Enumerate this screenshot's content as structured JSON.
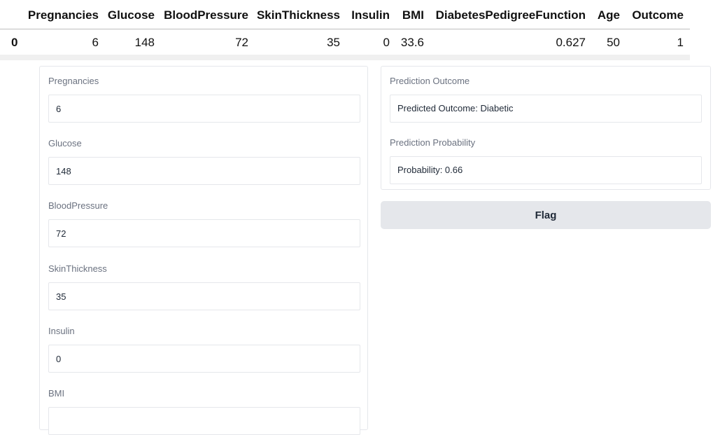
{
  "form": {
    "fields": [
      {
        "label": "Pregnancies",
        "value": "6"
      },
      {
        "label": "Glucose",
        "value": "148"
      },
      {
        "label": "BloodPressure",
        "value": "72"
      },
      {
        "label": "SkinThickness",
        "value": "35"
      },
      {
        "label": "Insulin",
        "value": "0"
      },
      {
        "label": "BMI",
        "value": ""
      }
    ]
  },
  "outputs": {
    "outcome_label": "Prediction Outcome",
    "outcome_value": "Predicted Outcome: Diabetic",
    "probability_label": "Prediction Probability",
    "probability_value": "Probability: 0.66"
  },
  "flag_label": "Flag",
  "dataframe": {
    "columns": [
      "",
      "Pregnancies",
      "Glucose",
      "BloodPressure",
      "SkinThickness",
      "Insulin",
      "BMI",
      "DiabetesPedigreeFunction",
      "Age",
      "Outcome"
    ],
    "row": [
      "0",
      "6",
      "148",
      "72",
      "35",
      "0",
      "33.6",
      "0.627",
      "50",
      "1"
    ]
  }
}
